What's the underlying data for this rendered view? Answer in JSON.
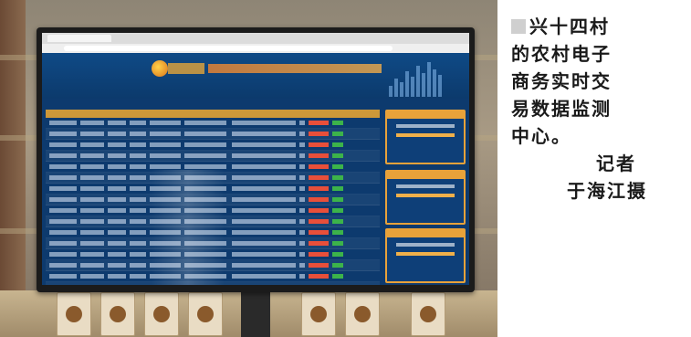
{
  "caption": {
    "lines": [
      "兴十四村",
      "的农村电子",
      "商务实时交",
      "易数据监测",
      "中心。"
    ],
    "credit_label": "记者",
    "credit_name": "于海江摄"
  },
  "photo": {
    "subject": "monitor",
    "accent_colors": {
      "screen_bg": "#0d3a6e",
      "header_orange": "#e2a333",
      "value_red": "#e84f3a",
      "status_green": "#3cb34a"
    }
  }
}
